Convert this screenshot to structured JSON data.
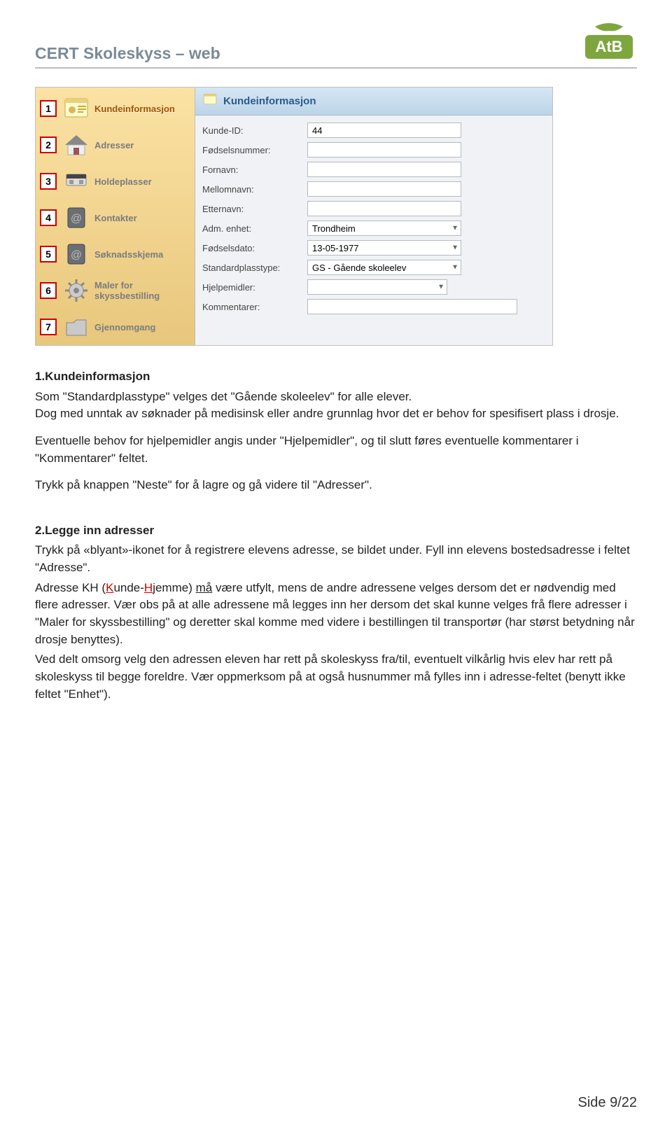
{
  "header": {
    "doc_title": "CERT Skoleskyss – web",
    "logo_text": "AtB"
  },
  "sidebar": {
    "items": [
      {
        "num": "1",
        "label": "Kundeinformasjon",
        "active": true
      },
      {
        "num": "2",
        "label": "Adresser"
      },
      {
        "num": "3",
        "label": "Holdeplasser"
      },
      {
        "num": "4",
        "label": "Kontakter"
      },
      {
        "num": "5",
        "label": "Søknadsskjema"
      },
      {
        "num": "6",
        "label": "Maler for skyssbestilling"
      },
      {
        "num": "7",
        "label": "Gjennomgang"
      }
    ]
  },
  "panel": {
    "title": "Kundeinformasjon",
    "fields": {
      "kunde_id_label": "Kunde-ID:",
      "kunde_id_value": "44",
      "fodselsnummer_label": "Fødselsnummer:",
      "fodselsnummer_value": "",
      "fornavn_label": "Fornavn:",
      "fornavn_value": "",
      "mellomnavn_label": "Mellomnavn:",
      "mellomnavn_value": "",
      "etternavn_label": "Etternavn:",
      "etternavn_value": "",
      "adm_enhet_label": "Adm. enhet:",
      "adm_enhet_value": "Trondheim",
      "fodselsdato_label": "Fødselsdato:",
      "fodselsdato_value": "13-05-1977",
      "standardplasstype_label": "Standardplasstype:",
      "standardplasstype_value": "GS - Gående skoleelev",
      "hjelpemidler_label": "Hjelpemidler:",
      "hjelpemidler_value": "",
      "kommentarer_label": "Kommentarer:",
      "kommentarer_value": ""
    }
  },
  "text": {
    "s1_title": "1.Kundeinformasjon",
    "s1_p1": "Som \"Standardplasstype\" velges det \"Gående skoleelev\" for alle elever.",
    "s1_p2": "Dog med unntak av søknader på medisinsk eller andre grunnlag hvor det er behov for spesifisert plass i drosje.",
    "s1_p3": "Eventuelle behov for hjelpemidler angis under \"Hjelpemidler\", og til slutt føres eventuelle kommentarer i \"Kommentarer\" feltet.",
    "s1_p4": "Trykk på knappen \"Neste\" for å lagre og gå videre til \"Adresser\".",
    "s2_title": "2.Legge inn adresser",
    "s2_p1": "Trykk på «blyant»-ikonet for å registrere elevens adresse, se bildet under. Fyll inn elevens bostedsadresse i feltet \"Adresse\".",
    "s2_p2a": "Adresse KH (",
    "s2_p2b": "unde-",
    "s2_p2c": "jemme) ",
    "s2_p2d": " være utfylt, mens de andre adressene velges dersom det er nødvendig med flere adresser. Vær obs på at alle adressene må legges inn her dersom det skal kunne velges frå flere adresser i \"Maler for skyssbestilling\" og deretter skal komme med videre i bestillingen til transportør (har størst betydning når drosje benyttes).",
    "s2_p3": "Ved delt omsorg velg den adressen eleven har rett på skoleskyss fra/til, eventuelt vilkårlig hvis elev har rett på skoleskyss til begge foreldre. Vær oppmerksom på at også husnummer må fylles inn i adresse-feltet (benytt ikke feltet \"Enhet\").",
    "kh_K": "K",
    "kh_H": "H",
    "ma": "må"
  },
  "footer": {
    "page_label": "Side 9/22"
  }
}
